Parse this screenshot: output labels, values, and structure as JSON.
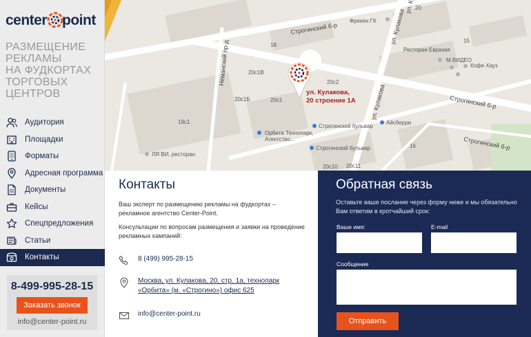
{
  "logo": {
    "left": "center",
    "right": "point"
  },
  "tagline": [
    "РАЗМЕЩЕНИЕ",
    "РЕКЛАМЫ",
    "НА ФУДКОРТАХ",
    "ТОРГОВЫХ",
    "ЦЕНТРОВ"
  ],
  "menu": [
    {
      "label": "Аудитория",
      "icon": "users-icon",
      "active": false
    },
    {
      "label": "Площадки",
      "icon": "building-icon",
      "active": false
    },
    {
      "label": "Форматы",
      "icon": "tablet-icon",
      "active": false
    },
    {
      "label": "Адресная программа",
      "icon": "location-icon",
      "active": false
    },
    {
      "label": "Документы",
      "icon": "document-icon",
      "active": false
    },
    {
      "label": "Кейсы",
      "icon": "briefcase-icon",
      "active": false
    },
    {
      "label": "Спецпредложения",
      "icon": "star-icon",
      "active": false
    },
    {
      "label": "Статьи",
      "icon": "newspaper-icon",
      "active": false
    },
    {
      "label": "Контакты",
      "icon": "phone-icon",
      "active": true
    }
  ],
  "callbox": {
    "phone": "8-499-995-28-15",
    "button": "Заказать звонок",
    "email": "info@center-point.ru"
  },
  "map": {
    "pin_label_line1": "ул. Кулакова,",
    "pin_label_line2": "20 строение 1А",
    "labels": {
      "road1": "Строгинский б-р",
      "road2": "Строгинский б-р",
      "road3": "Строгинский б-р",
      "kulakova1": "ул. Кулакова",
      "kulakova2": "ул. Кулакова",
      "kulakova3": "ул. Кулакова",
      "nemansky": "Неманский пр-д",
      "freken": "Фрекен ГК",
      "restoran": "Ресторан Евразия",
      "mvideo": "М.ВИДЕО",
      "kofe": "Кофе Хауз",
      "orbita": "Орбита Технопарк,",
      "agentstvo": "Агентство...",
      "bulvar1": "Строгинский бульвар",
      "bulvar2": "Строгинский бульвар",
      "aisberi": "Айсберри",
      "lyavi": "ЛЯ ВИ, ресторан",
      "b20c1b": "20с1Б",
      "b20c1v": "20с1В",
      "b19c1": "19с1",
      "b20c1": "20с1",
      "b20c2": "20с2",
      "b18": "18",
      "b20c10": "20с10",
      "b20c11": "20с11",
      "b15": "15",
      "b20": "20",
      "b16": "16"
    }
  },
  "contacts": {
    "title": "Контакты",
    "intro": "Ваш эксперт по размещению рекламы на фудкортах – рекламное агентство Center-Point.",
    "consult": "Консультации по вопросам размещения и заявки на проведение рекламных кампаний:",
    "phone": "8 (499) 995-28-15",
    "address_line1": "Москва, ул. Кулакова, 20, стр. 1а, технопарк",
    "address_line2": "«Орбита» (м. «Строгино») офис 625",
    "email": "info@center-point.ru"
  },
  "feedback": {
    "title": "Обратная связь",
    "description": "Оставьте ваше послание через форму ниже и мы обязательно Вам ответим в кротчайший срок:",
    "name_label": "Ваше имя:",
    "email_label": "E-mail",
    "message_label": "Сообщение",
    "name_value": "",
    "email_value": "",
    "message_value": "",
    "submit": "Отправить"
  },
  "colors": {
    "navy": "#1b2a55",
    "orange": "#e8531d",
    "sidebar_bg": "#ececec"
  }
}
